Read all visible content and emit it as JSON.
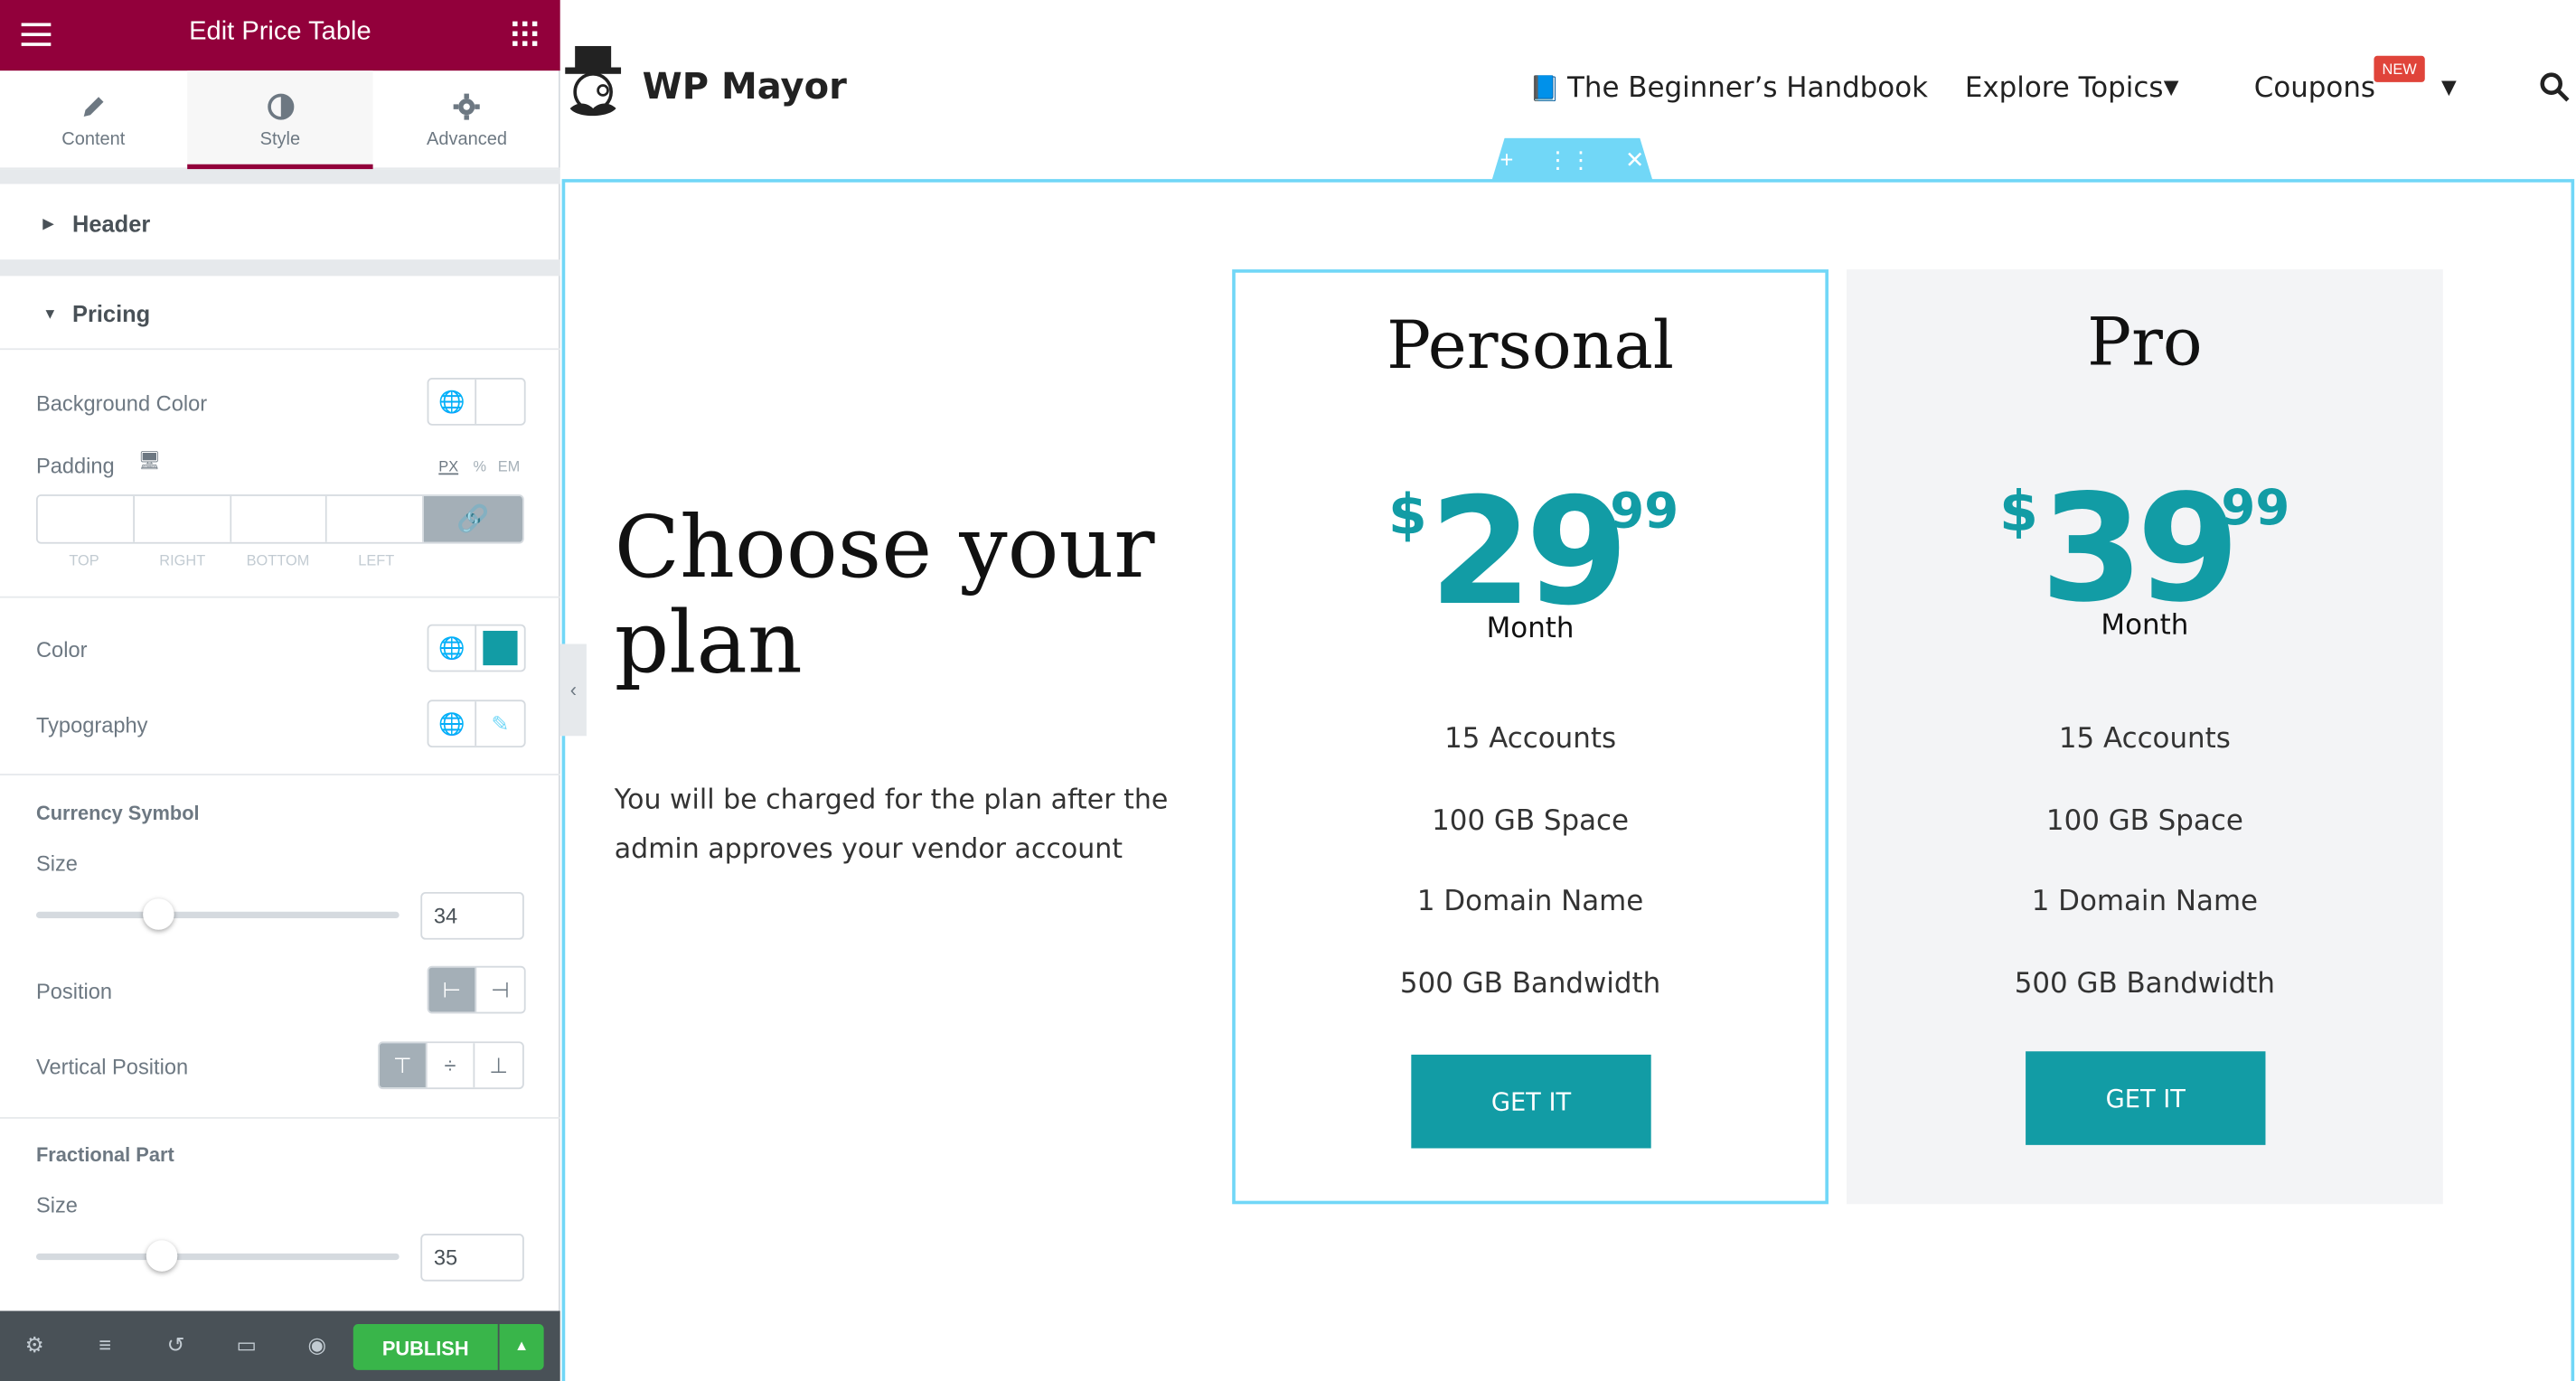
{
  "panel": {
    "title": "Edit Price Table",
    "tabs": [
      {
        "label": "Content"
      },
      {
        "label": "Style"
      },
      {
        "label": "Advanced"
      }
    ],
    "sections": {
      "header": "Header",
      "pricing": "Pricing"
    },
    "controls": {
      "background_color": "Background Color",
      "padding": "Padding",
      "units": [
        "PX",
        "%",
        "EM"
      ],
      "padding_sides": [
        "TOP",
        "RIGHT",
        "BOTTOM",
        "LEFT"
      ],
      "color": "Color",
      "color_swatch": "#129ca5",
      "typography": "Typography",
      "currency_symbol": "Currency Symbol",
      "currency_size_label": "Size",
      "currency_size_value": "34",
      "position": "Position",
      "vertical_position": "Vertical Position",
      "fractional_part": "Fractional Part",
      "fractional_size_label": "Size",
      "fractional_size_value": "35"
    },
    "publish": "PUBLISH"
  },
  "site": {
    "brand": "WP Mayor",
    "nav": {
      "handbook": "The Beginner’s Handbook",
      "topics": "Explore Topics",
      "coupons": "Coupons",
      "new_badge": "NEW"
    },
    "heading": "Choose your plan",
    "description": "You will be charged for the plan after the admin approves your vendor account",
    "plans": [
      {
        "name": "Personal",
        "currency": "$",
        "integer": "29",
        "fraction": "99",
        "period": "Month",
        "features": [
          "15 Accounts",
          "100 GB Space",
          "1 Domain Name",
          "500 GB Bandwidth"
        ],
        "button": "GET IT"
      },
      {
        "name": "Pro",
        "currency": "$",
        "integer": "39",
        "fraction": "99",
        "period": "Month",
        "features": [
          "15 Accounts",
          "100 GB Space",
          "1 Domain Name",
          "500 GB Bandwidth"
        ],
        "button": "GET IT"
      }
    ],
    "accent": "#129ca5"
  }
}
